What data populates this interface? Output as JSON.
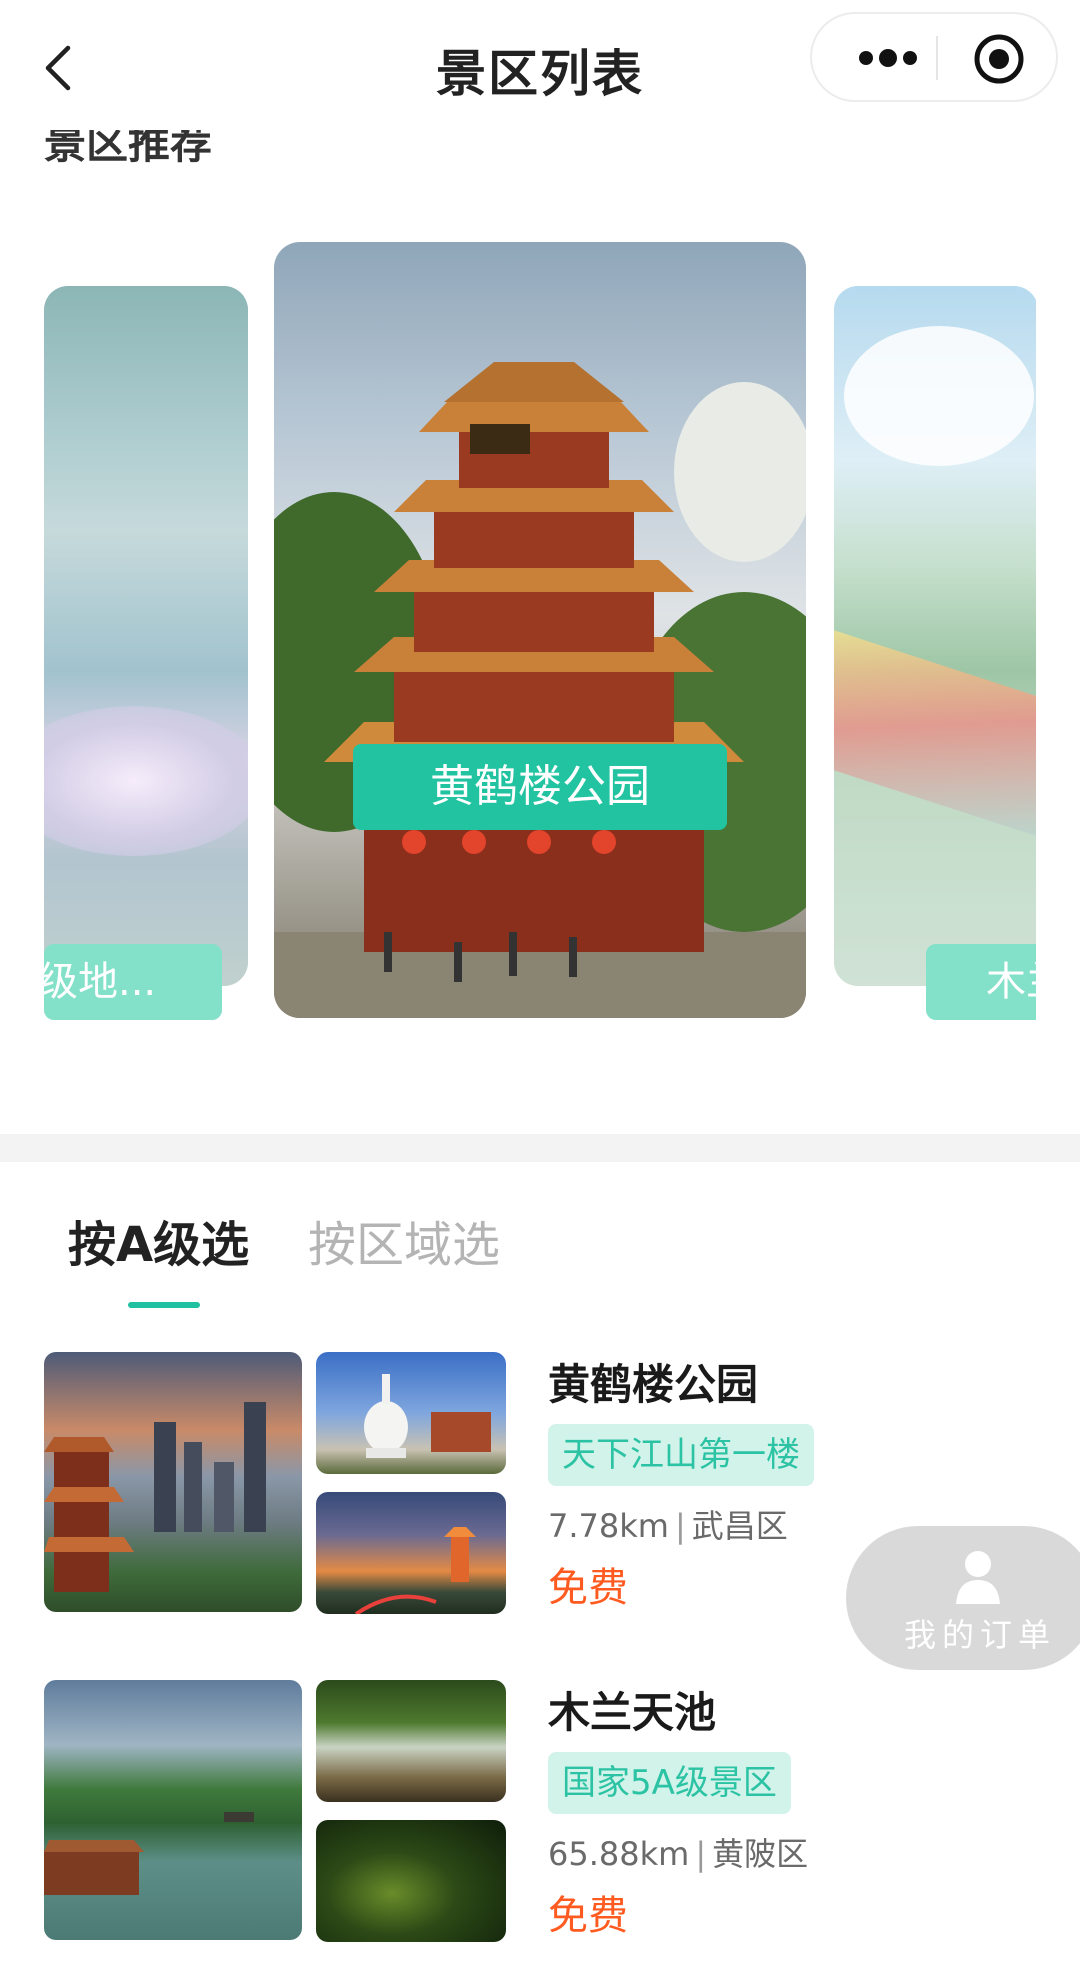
{
  "navbar": {
    "title": "景区列表",
    "back_icon": "back-icon",
    "menu_icon": "more-icon",
    "close_icon": "target-icon"
  },
  "section": {
    "title": "景区推荐"
  },
  "carousel": {
    "left_label": "级地...",
    "center_label": "黄鹤楼公园",
    "right_label": "木兰"
  },
  "tabs": [
    {
      "label": "按A级选",
      "active": true
    },
    {
      "label": "按区域选",
      "active": false
    }
  ],
  "list": [
    {
      "name": "黄鹤楼公园",
      "tag": "天下江山第一楼",
      "distance": "7.78km",
      "separator": "|",
      "district": "武昌区",
      "price": "免费"
    },
    {
      "name": "木兰天池",
      "tag": "国家5A级景区",
      "distance": "65.88km",
      "separator": "|",
      "district": "黄陂区",
      "price": "免费"
    }
  ],
  "float_button": {
    "label": "我的订单",
    "icon": "person-icon"
  },
  "colors": {
    "accent": "#21c3a1",
    "tag_bg": "#d2f3ea",
    "price": "#ff5a1f"
  }
}
